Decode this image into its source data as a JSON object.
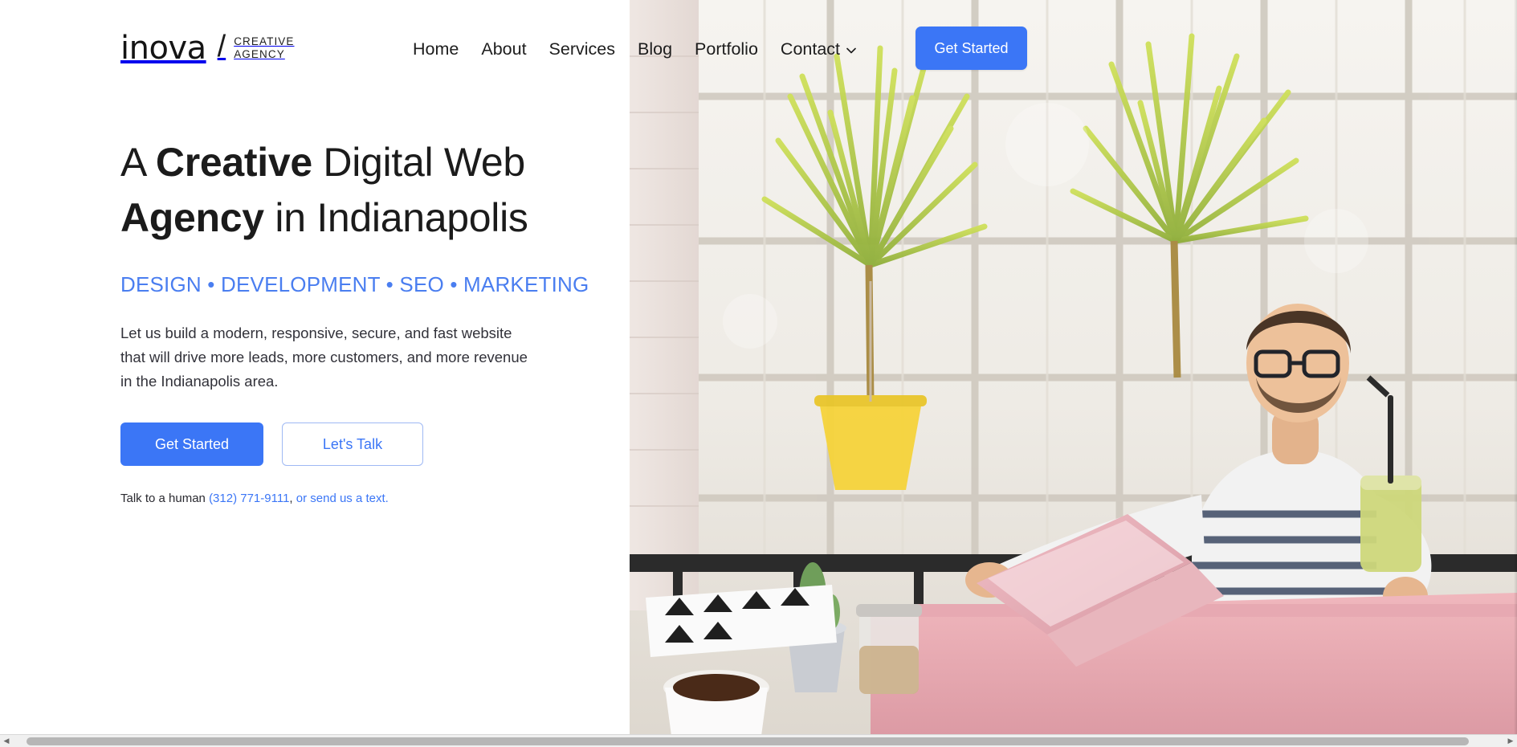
{
  "brand": {
    "name": "inova",
    "separator": "/",
    "tagline_line1": "CREATIVE",
    "tagline_line2": "AGENCY"
  },
  "nav": {
    "items": [
      {
        "label": "Home",
        "has_dropdown": false
      },
      {
        "label": "About",
        "has_dropdown": false
      },
      {
        "label": "Services",
        "has_dropdown": false
      },
      {
        "label": "Blog",
        "has_dropdown": false
      },
      {
        "label": "Portfolio",
        "has_dropdown": false
      },
      {
        "label": "Contact",
        "has_dropdown": true
      }
    ],
    "cta_label": "Get Started",
    "cta_color": "#3b76f6"
  },
  "hero": {
    "title_part1": "A ",
    "title_bold1": "Creative",
    "title_part2": " Digital Web ",
    "title_bold2": "Agency",
    "title_part3": " in Indianapolis",
    "tagline": "DESIGN • DEVELOPMENT • SEO • MARKETING",
    "tagline_color": "#4a7ef0",
    "description": "Let us build a modern, responsive, secure, and fast website that will drive more leads, more customers, and more revenue in the Indianapolis area.",
    "primary_button": "Get Started",
    "secondary_button": "Let's Talk",
    "contact_prefix": "Talk to a human ",
    "contact_phone": "(312) 771-9111",
    "contact_separator": ", ",
    "contact_text_link": "or send us a text.",
    "link_color": "#3b76f6"
  },
  "scrollbar": {
    "left_arrow": "◀",
    "right_arrow": "▶"
  }
}
